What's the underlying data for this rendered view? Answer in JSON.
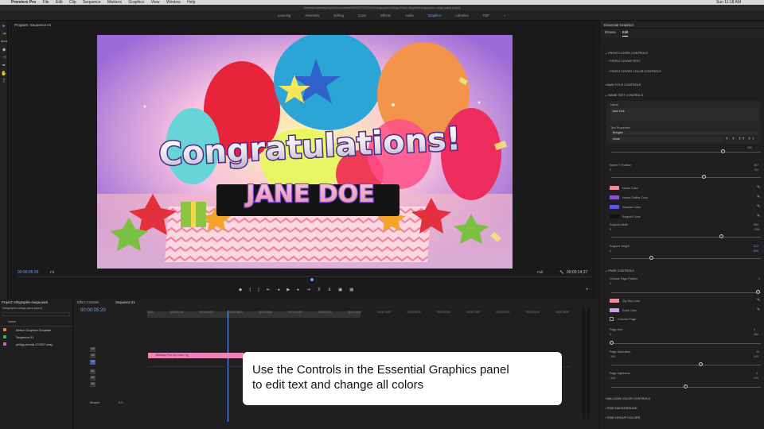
{
  "menubar": {
    "app": "Premiere Pro",
    "items": [
      "File",
      "Edit",
      "Clip",
      "Sequence",
      "Markers",
      "Graphics",
      "View",
      "Window",
      "Help"
    ],
    "clock": "Sun 11:18 AM"
  },
  "path": "/Users/marissaprolys/Documents/MOGRTS/2020-Infographic-Mega-Pack-Mogrts/Infographic-mega-pack.prproj",
  "workspaces": {
    "tabs": [
      "Learning",
      "Assembly",
      "Editing",
      "Color",
      "Effects",
      "Audio",
      "Graphics",
      "Libraries",
      "TDP"
    ],
    "active": "Graphics"
  },
  "program": {
    "tab": "Program: Sequence 01",
    "timecode_left": "00;00;05;20",
    "fit": "Fit",
    "quality": "Full",
    "timecode_right": "00;00;14;27"
  },
  "video": {
    "headline": "Congratulations!",
    "name": "JANE DOE"
  },
  "project": {
    "tab": "Project: Infographic-mega-pack",
    "file": "Infographic-mega-pack.prproj",
    "name_header": "Name",
    "items": [
      "Motion Graphics Template",
      "Sequence 01",
      "philipp-berndt-170297-unsp"
    ]
  },
  "timeline": {
    "tabs": [
      "Effect Controls",
      "Sequence 01"
    ],
    "timecode": "00;00;05;20",
    "ruler": [
      "00;00",
      "00;00;02;00",
      "00;00;04;00",
      "00;00;06;00",
      "00;00;08;00",
      "00;00;10;00",
      "00;00;12;00",
      "00;00;14;00",
      "00;00;16;00",
      "00;00;18;00",
      "00;00;20;00",
      "00;00;22;00",
      "00;00;24;00",
      "00;00;26;00",
      "00;00;28;00"
    ],
    "video_tracks": [
      "V3",
      "V2",
      "V1"
    ],
    "audio_tracks": [
      "A1",
      "A2",
      "A3"
    ],
    "clip": "Birthday Pop Up Card / fig",
    "master": "Master",
    "master_val": "0.0"
  },
  "eg": {
    "title": "Essential Graphics",
    "tabs": [
      "Browse",
      "Edit"
    ],
    "active_tab": "Edit",
    "sections": {
      "front_cover": "FRONT COVER CONTROLS",
      "front_cover_text": "FRONT COVER TEXT",
      "front_cover_color": "FRONT COVER COLOR CONTROLS",
      "main_title": "MAIN TITLE CONTROLS",
      "name_text": "NAME TEXT CONTROLS",
      "page": "PAGE CONTROLS",
      "balloon": "BALLOON COLOR CONTROLS",
      "star_bg": "STAR BACKGROUND",
      "star_group": "STAR GROUP COLORS"
    },
    "name_label": "Name",
    "name_value": "Jane Doe",
    "text_props": "Text Properties",
    "font": "Bungee",
    "style": "Inline",
    "font_size": "200",
    "name_y": {
      "label": "Name Y Position",
      "value": "497",
      "min": "0",
      "max": "700",
      "level": 0.71
    },
    "colors": [
      {
        "label": "Name Color",
        "hex": "#f08a9a"
      },
      {
        "label": "Name Outline Color",
        "hex": "#8e4fd8"
      },
      {
        "label": "Shadow Color",
        "hex": "#5a56e8"
      },
      {
        "label": "Support Color",
        "hex": "#111111"
      }
    ],
    "support_width": {
      "label": "Support Width",
      "value": "980",
      "min": "0",
      "max": "1300",
      "level": 0.75
    },
    "support_height": {
      "label": "Support Height",
      "value": "212",
      "min": "0",
      "max": "800",
      "level": 0.27
    },
    "page_pattern": {
      "label": "Choose Page Pattern",
      "min": "1",
      "max": "4",
      "value": "4"
    },
    "page_colors": [
      {
        "label": "Zig Zag Color",
        "hex": "#f08a9a"
      },
      {
        "label": "Solid Color",
        "hex": "#c9a0e0"
      }
    ],
    "colorize_page": "Colorize Page",
    "page_hue": {
      "label": "Page Hue",
      "min": "0",
      "max": "360",
      "value": "0",
      "level": 0.0
    },
    "page_saturation": {
      "label": "Page Saturation",
      "min": "-100",
      "max": "100",
      "value": "10",
      "level": 0.55
    },
    "page_lightness": {
      "label": "Page Lightness",
      "min": "-100",
      "max": "100",
      "value": "0",
      "level": 0.5
    }
  },
  "caption": {
    "line1": "Use the Controls in the Essential Graphics panel",
    "line2": "to edit text and change all colors"
  }
}
